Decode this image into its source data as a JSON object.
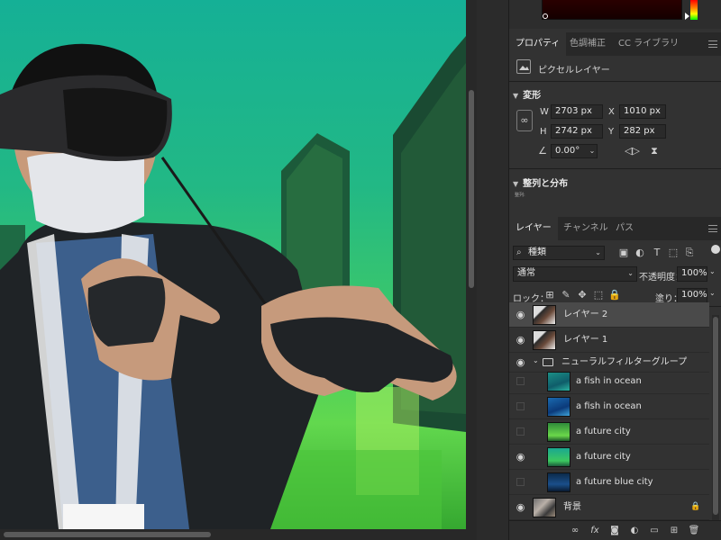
{
  "colors": {
    "accent": "#1473e6",
    "panel_bg": "#323232",
    "selected_row": "#4a4a4a"
  },
  "properties_tabs": [
    {
      "label": "プロパティ",
      "active": true
    },
    {
      "label": "色調補正",
      "active": false
    },
    {
      "label": "CC ライブラリ",
      "active": false
    }
  ],
  "properties": {
    "layer_type": "ピクセルレイヤー",
    "transform_title": "変形",
    "w_label": "W",
    "w_value": "2703 px",
    "x_label": "X",
    "x_value": "1010 px",
    "h_label": "H",
    "h_value": "2742 px",
    "y_label": "Y",
    "y_value": "282 px",
    "angle_value": "0.00°",
    "align_title": "整列と分布",
    "align_sub": "整列:"
  },
  "layers_tabs": [
    {
      "label": "レイヤー",
      "active": true
    },
    {
      "label": "チャンネル",
      "active": false
    },
    {
      "label": "パス",
      "active": false
    }
  ],
  "layers_panel": {
    "filter_kind": "種類",
    "blend_mode": "通常",
    "opacity_label": "不透明度：",
    "opacity_value": "100%",
    "lock_label": "ロック：",
    "fill_label": "塗り：",
    "fill_value": "100%"
  },
  "layers": [
    {
      "name": "レイヤー 2",
      "visible": true,
      "selected": true,
      "thumb": "person"
    },
    {
      "name": "レイヤー 1",
      "visible": true,
      "selected": false,
      "thumb": "person"
    },
    {
      "name": "ニューラルフィルターグループ",
      "visible": true,
      "selected": false,
      "thumb": "folder"
    },
    {
      "name": "a fish in ocean",
      "visible": false,
      "selected": false,
      "thumb": "ocean"
    },
    {
      "name": "a fish in ocean",
      "visible": false,
      "selected": false,
      "thumb": "ocean-blue"
    },
    {
      "name": "a future city",
      "visible": false,
      "selected": false,
      "thumb": "city-green"
    },
    {
      "name": "a future city",
      "visible": true,
      "selected": false,
      "thumb": "city-teal"
    },
    {
      "name": "a future blue city",
      "visible": false,
      "selected": false,
      "thumb": "city-blue"
    },
    {
      "name": "背景",
      "visible": true,
      "selected": false,
      "thumb": "person",
      "locked": true
    }
  ],
  "footer_icons": [
    "link-icon",
    "fx-icon",
    "mask-icon",
    "adjustment-icon",
    "folder-icon",
    "new-layer-icon",
    "trash-icon"
  ]
}
